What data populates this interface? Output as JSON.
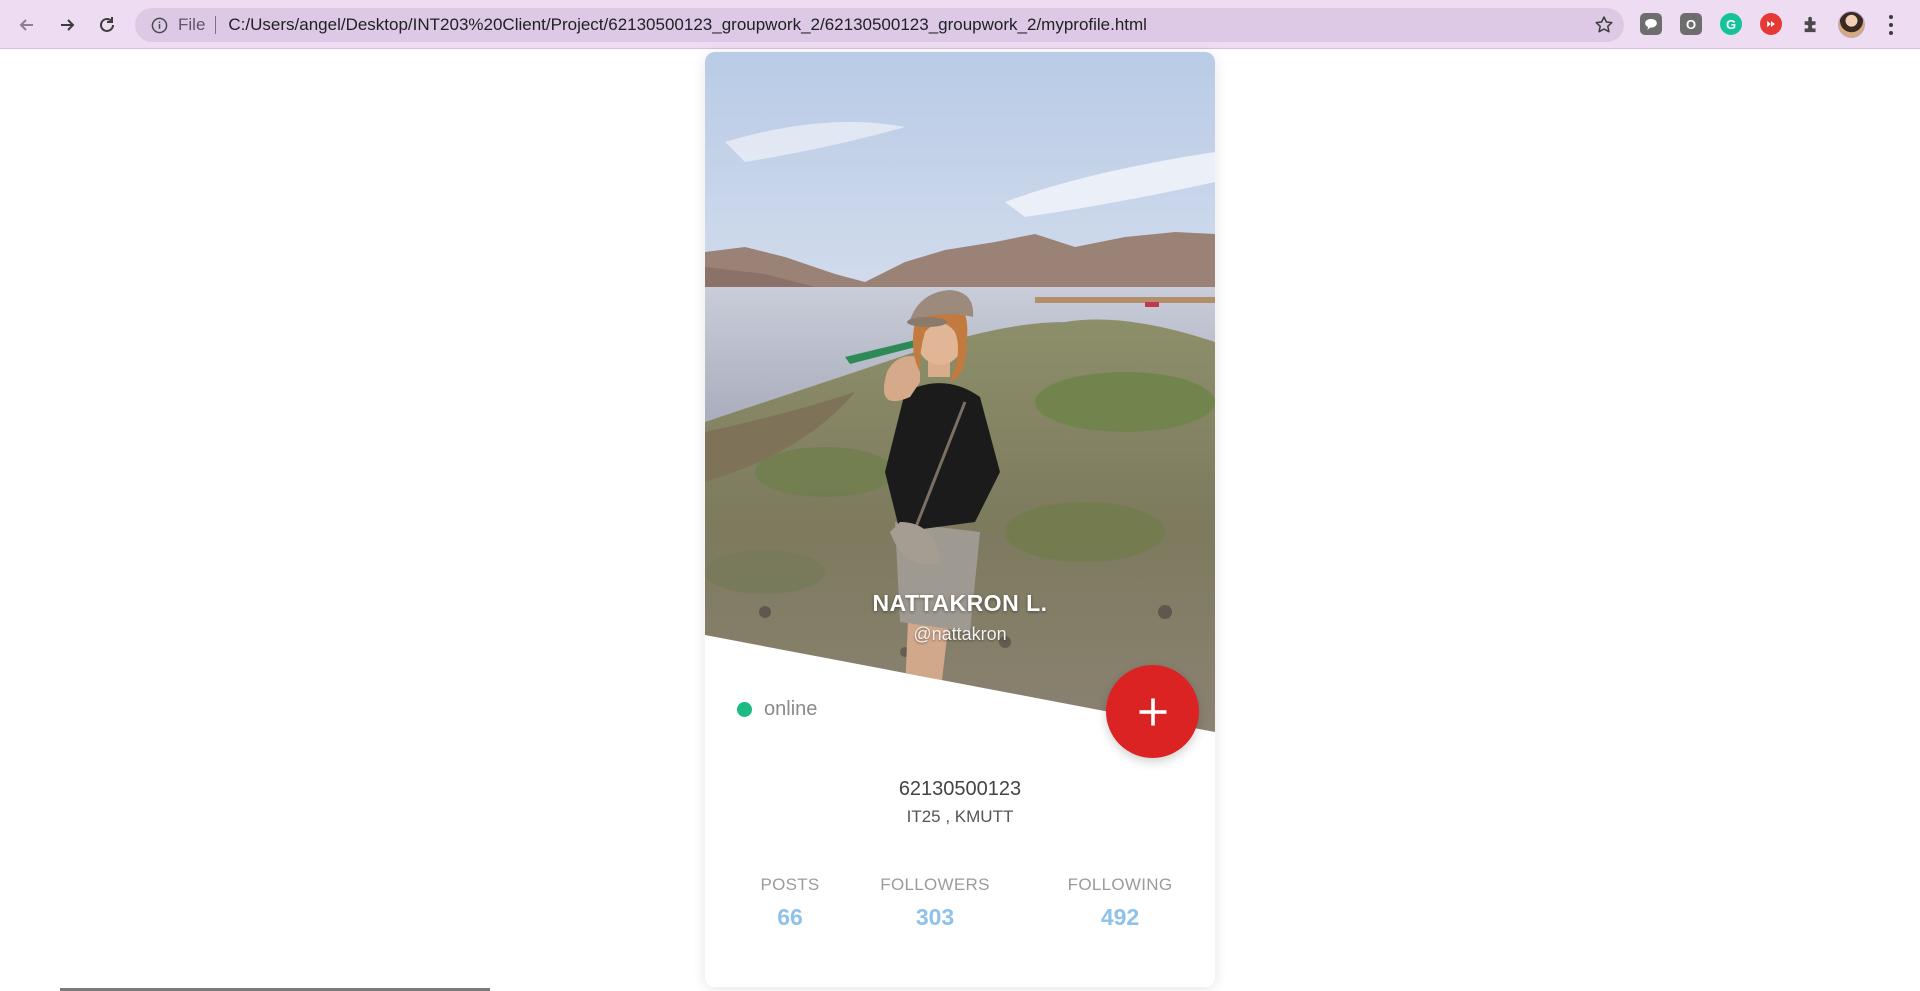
{
  "browser": {
    "file_label": "File",
    "url": "C:/Users/angel/Desktop/INT203%20Client/Project/62130500123_groupwork_2/62130500123_groupwork_2/myprofile.html",
    "extensions": [
      {
        "name": "line-icon",
        "color": "#6a6a6a"
      },
      {
        "name": "o-extension-icon",
        "color": "#6a6a6a"
      },
      {
        "name": "grammarly-icon",
        "color": "#15c39a"
      },
      {
        "name": "record-icon",
        "color": "#e53935"
      },
      {
        "name": "puzzle-icon",
        "color": "#5a5a5a"
      }
    ]
  },
  "profile": {
    "name": "NATTAKRON L.",
    "handle": "@nattakron",
    "status": "online",
    "status_color": "#1dbb83",
    "student_id": "62130500123",
    "school": "IT25 , KMUTT",
    "fab_color": "#dc2323",
    "stats": [
      {
        "label": "POSTS",
        "value": "66"
      },
      {
        "label": "FOLLOWERS",
        "value": "303"
      },
      {
        "label": "FOLLOWING",
        "value": "492"
      }
    ]
  }
}
